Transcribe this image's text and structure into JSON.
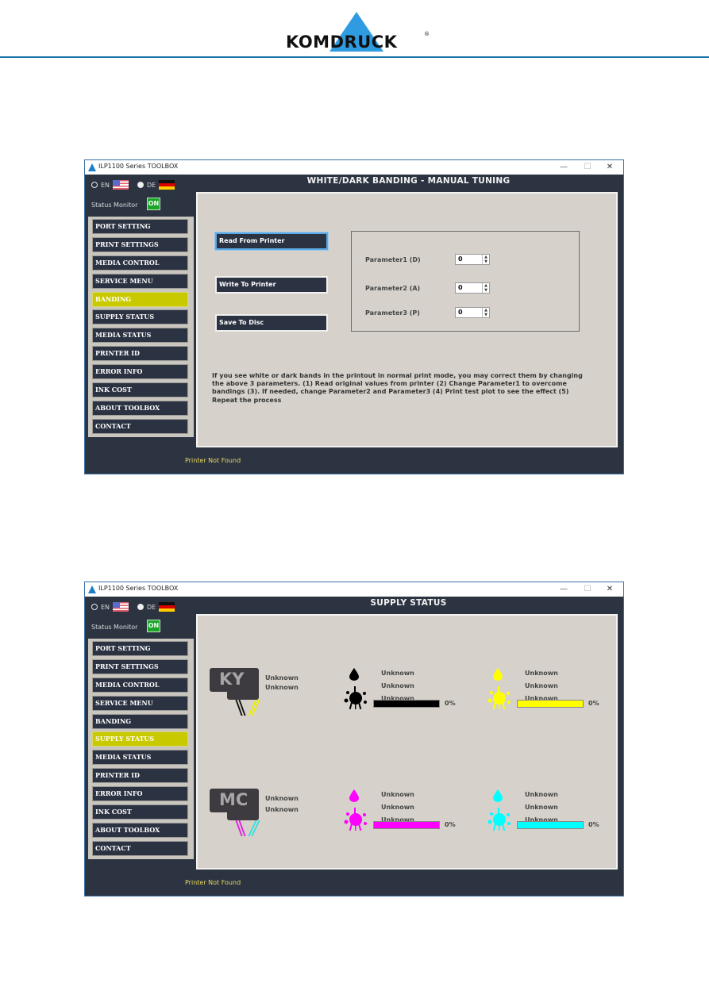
{
  "brand": {
    "logo_text_left": "KOM",
    "logo_text_mid": "DRU",
    "logo_text_right": "CK",
    "registered": "®",
    "accent_color": "#2f9be0"
  },
  "windows": [
    {
      "title": "ILP1100 Series TOOLBOX",
      "controls": {
        "minimize": "—",
        "maximize": "☐",
        "close": "✕"
      },
      "languages": [
        {
          "code": "EN",
          "selected": false
        },
        {
          "code": "DE",
          "selected": true
        }
      ],
      "status_monitor": {
        "label": "Status Monitor",
        "state": "ON"
      },
      "sidebar": {
        "items": [
          "PORT SETTING",
          "PRINT SETTINGS",
          "MEDIA CONTROL",
          "SERVICE MENU",
          "BANDING",
          "SUPPLY STATUS",
          "MEDIA STATUS",
          "PRINTER ID",
          "ERROR INFO",
          "INK COST",
          "ABOUT TOOLBOX",
          "CONTACT"
        ],
        "active": "BANDING"
      },
      "page_title": "WHITE/DARK BANDING - MANUAL TUNING",
      "buttons": {
        "read": "Read From Printer",
        "write": "Write To Printer",
        "save": "Save To Disc"
      },
      "parameters": [
        {
          "label": "Parameter1 (D)",
          "value": "0"
        },
        {
          "label": "Parameter2 (A)",
          "value": "0"
        },
        {
          "label": "Parameter3 (P)",
          "value": "0"
        }
      ],
      "help_text": "If you see white or dark bands in the printout in normal print mode, you may correct them by changing the above 3 parameters. (1) Read original values from printer (2) Change Parameter1 to overcome bandings (3). If needed, change Parameter2 and Parameter3 (4) Print test plot to see the effect (5) Repeat the process",
      "footer_status": "Printer Not Found"
    },
    {
      "title": "ILP1100 Series TOOLBOX",
      "controls": {
        "minimize": "—",
        "maximize": "☐",
        "close": "✕"
      },
      "languages": [
        {
          "code": "EN",
          "selected": false
        },
        {
          "code": "DE",
          "selected": true
        }
      ],
      "status_monitor": {
        "label": "Status Monitor",
        "state": "ON"
      },
      "sidebar": {
        "items": [
          "PORT SETTING",
          "PRINT SETTINGS",
          "MEDIA CONTROL",
          "SERVICE MENU",
          "BANDING",
          "SUPPLY STATUS",
          "MEDIA STATUS",
          "PRINTER ID",
          "ERROR INFO",
          "INK COST",
          "ABOUT TOOLBOX",
          "CONTACT"
        ],
        "active": "SUPPLY STATUS"
      },
      "page_title": "SUPPLY STATUS",
      "cartridges": [
        {
          "code": "KY",
          "lines": [
            "Unknown",
            "Unknown"
          ],
          "tube_colors": [
            "#111111",
            "#f0f000"
          ]
        },
        {
          "code": "MC",
          "lines": [
            "Unknown",
            "Unknown"
          ],
          "tube_colors": [
            "#e020e0",
            "#30e0e0"
          ]
        }
      ],
      "inks": [
        {
          "name": "black",
          "color": "#000000",
          "lines": [
            "Unknown",
            "Unknown",
            "Unknown"
          ],
          "level_percent": 0,
          "level_label": "0%"
        },
        {
          "name": "yellow",
          "color": "#ffff00",
          "lines": [
            "Unknown",
            "Unknown",
            "Unknown"
          ],
          "level_percent": 0,
          "level_label": "0%"
        },
        {
          "name": "magenta",
          "color": "#ff00ff",
          "lines": [
            "Unknown",
            "Unknown",
            "Unknown"
          ],
          "level_percent": 0,
          "level_label": "0%"
        },
        {
          "name": "cyan",
          "color": "#00ffff",
          "lines": [
            "Unknown",
            "Unknown",
            "Unknown"
          ],
          "level_percent": 0,
          "level_label": "0%"
        }
      ],
      "footer_status": "Printer Not Found"
    }
  ]
}
